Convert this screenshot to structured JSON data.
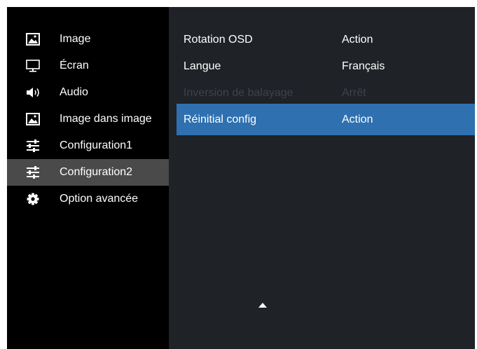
{
  "sidebar": {
    "items": [
      {
        "label": "Image",
        "icon": "picture-icon",
        "selected": false
      },
      {
        "label": "Écran",
        "icon": "monitor-icon",
        "selected": false
      },
      {
        "label": "Audio",
        "icon": "speaker-icon",
        "selected": false
      },
      {
        "label": "Image dans image",
        "icon": "picture-icon",
        "selected": false
      },
      {
        "label": "Configuration1",
        "icon": "sliders-icon",
        "selected": false
      },
      {
        "label": "Configuration2",
        "icon": "sliders-icon",
        "selected": true
      },
      {
        "label": "Option avancée",
        "icon": "gear-icon",
        "selected": false
      }
    ]
  },
  "settings": {
    "rows": [
      {
        "label": "Rotation OSD",
        "value": "Action",
        "enabled": true,
        "highlighted": false
      },
      {
        "label": "Langue",
        "value": "Français",
        "enabled": true,
        "highlighted": false
      },
      {
        "label": "Inversion de balayage",
        "value": "Arrêt",
        "enabled": false,
        "highlighted": false
      },
      {
        "label": "Réinitial config",
        "value": "Action",
        "enabled": true,
        "highlighted": true
      }
    ]
  },
  "scroll_indicator": {
    "icon": "scroll-up-arrow-icon"
  },
  "colors": {
    "sidebar_bg": "#000000",
    "sidebar_selected": "#4a4a4a",
    "panel_bg": "#1f2227",
    "highlight": "#2f70b0",
    "disabled_text": "#3e4349",
    "text": "#ffffff"
  }
}
